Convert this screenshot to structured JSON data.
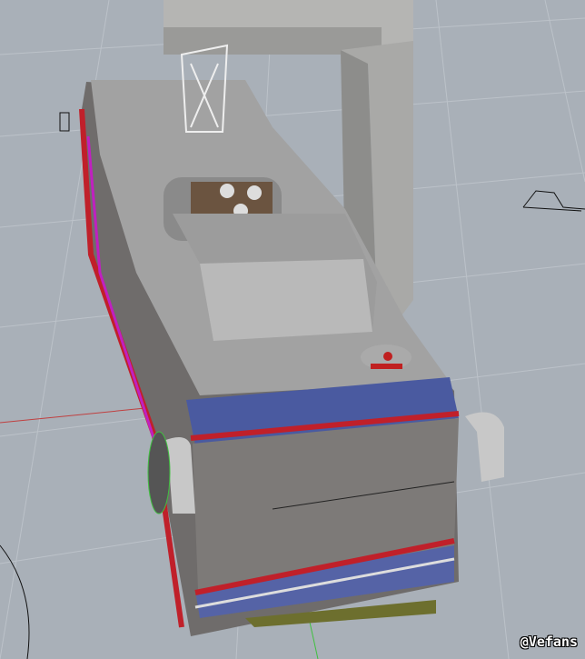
{
  "watermark": "@Vefans",
  "colors": {
    "background": "#a9b0b8",
    "grid": "#bcc2c9",
    "bus_body": "#7d7a78",
    "bus_roof": "#a0a0a0",
    "stripe_red": "#c0202a",
    "stripe_blue": "#4a5aa0",
    "window_magenta": "#c020c0",
    "axis_red": "#c04040",
    "axis_green": "#40c040"
  }
}
